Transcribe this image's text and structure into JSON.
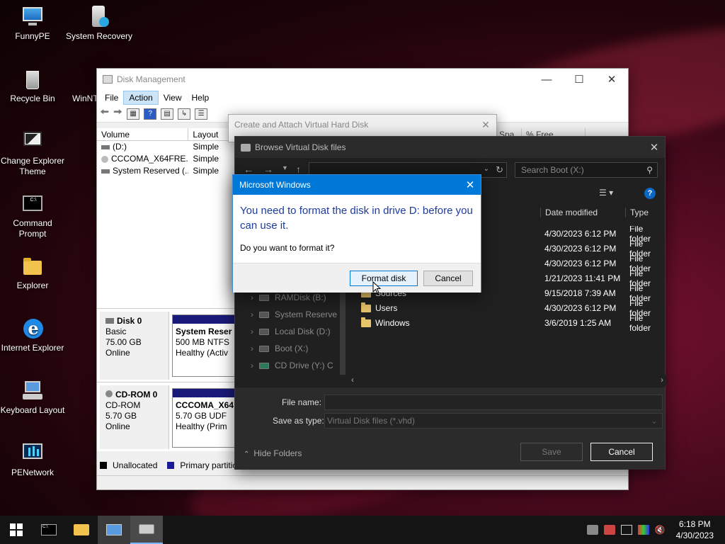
{
  "desktop": {
    "icons": [
      {
        "label": "FunnyPE",
        "icon": "computer-icon"
      },
      {
        "label": "System Recovery",
        "icon": "recovery-icon"
      },
      {
        "label": "Recycle Bin",
        "icon": "recycle-bin-icon"
      },
      {
        "label": "WinNT",
        "icon": "setup-icon"
      },
      {
        "label": "Change Explorer Theme",
        "icon": "monitor-icon"
      },
      {
        "label": "Command Prompt",
        "icon": "cmd-icon"
      },
      {
        "label": "Explorer",
        "icon": "folder-icon"
      },
      {
        "label": "Internet Explorer",
        "icon": "ie-icon"
      },
      {
        "label": "Keyboard Layout",
        "icon": "keyboard-icon"
      },
      {
        "label": "PENetwork",
        "icon": "network-icon"
      }
    ]
  },
  "disk_management": {
    "title": "Disk Management",
    "menu": [
      "File",
      "Action",
      "View",
      "Help"
    ],
    "active_menu": "Action",
    "columns": [
      "Volume",
      "Layout"
    ],
    "volumes": [
      {
        "name": "(D:)",
        "layout": "Simple"
      },
      {
        "name": "CCCOMA_X64FRE...",
        "layout": "Simple"
      },
      {
        "name": "System Reserved (...",
        "layout": "Simple"
      }
    ],
    "disks": [
      {
        "name": "Disk 0",
        "type": "Basic",
        "size": "75.00 GB",
        "status": "Online",
        "part_name": "System Reser",
        "part_size": "500 MB NTFS",
        "part_status": "Healthy (Activ"
      },
      {
        "name": "CD-ROM 0",
        "type": "CD-ROM",
        "size": "5.70 GB",
        "status": "Online",
        "part_name": "CCCOMA_X64",
        "part_size": "5.70 GB UDF",
        "part_status": "Healthy (Prim"
      }
    ],
    "legend": [
      "Unallocated",
      "Primary partition"
    ],
    "behind_cols": [
      "Spa",
      "% Free"
    ]
  },
  "create_vhd": {
    "title": "Create and Attach Virtual Hard Disk"
  },
  "browse": {
    "title": "Browse Virtual Disk files",
    "search_placeholder": "Search Boot (X:)",
    "col_date": "Date modified",
    "col_type": "Type",
    "rows": [
      {
        "name": "",
        "date": "4/30/2023 6:12 PM",
        "type": "File folder"
      },
      {
        "name": "",
        "date": "4/30/2023 6:12 PM",
        "type": "File folder"
      },
      {
        "name": "",
        "date": "4/30/2023 6:12 PM",
        "type": "File folder"
      },
      {
        "name": "",
        "date": "1/21/2023 11:41 PM",
        "type": "File folder"
      },
      {
        "name": "Sources",
        "date": "9/15/2018 7:39 AM",
        "type": "File folder"
      },
      {
        "name": "Users",
        "date": "4/30/2023 6:12 PM",
        "type": "File folder"
      },
      {
        "name": "Windows",
        "date": "3/6/2019 1:25 AM",
        "type": "File folder"
      }
    ],
    "nav": [
      "RAMDisk (B:)",
      "System Reserve",
      "Local Disk (D:)",
      "Boot (X:)",
      "CD Drive (Y:) C"
    ],
    "file_name_label": "File name:",
    "save_type_label": "Save as type:",
    "save_type_value": "Virtual Disk files (*.vhd)",
    "hide_folders": "Hide Folders",
    "save_label": "Save",
    "cancel_label": "Cancel"
  },
  "msgbox": {
    "title": "Microsoft Windows",
    "heading": "You need to format the disk in drive D: before you can use it.",
    "question": "Do you want to format it?",
    "primary": "Format disk",
    "secondary": "Cancel"
  },
  "clock": {
    "time": "6:18 PM",
    "date": "4/30/2023"
  },
  "colors": {
    "accent": "#0078d7",
    "heading": "#1e3c9c"
  }
}
